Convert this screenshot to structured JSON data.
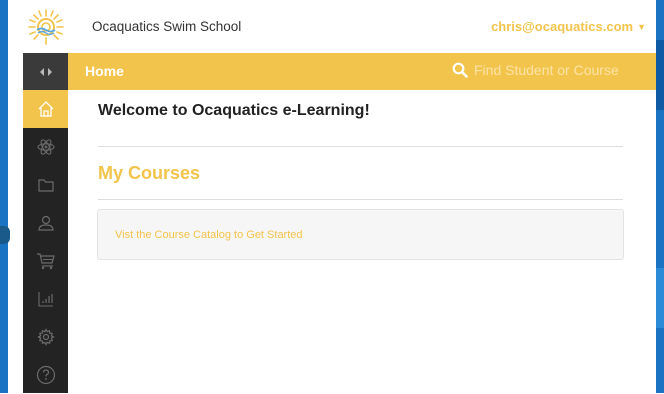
{
  "app": {
    "brand_name": "Ocaquatics Swim School",
    "user_email": "chris@ocaquatics.com",
    "accent_color": "#f3c44c",
    "sidebar_color": "#232323"
  },
  "titlebar": {
    "page_title": "Home",
    "search_placeholder": "Find Student or Course"
  },
  "sidebar": {
    "items": [
      {
        "icon": "home-icon",
        "active": true
      },
      {
        "icon": "atom-icon",
        "active": false
      },
      {
        "icon": "folder-icon",
        "active": false
      },
      {
        "icon": "user-icon",
        "active": false
      },
      {
        "icon": "cart-icon",
        "active": false
      },
      {
        "icon": "chart-icon",
        "active": false
      },
      {
        "icon": "gear-icon",
        "active": false
      },
      {
        "icon": "help-icon",
        "active": false
      }
    ]
  },
  "main": {
    "welcome": "Welcome to Ocaquatics e-Learning!",
    "section_title": "My Courses",
    "empty_link": "Vist the Course Catalog to Get Started"
  }
}
